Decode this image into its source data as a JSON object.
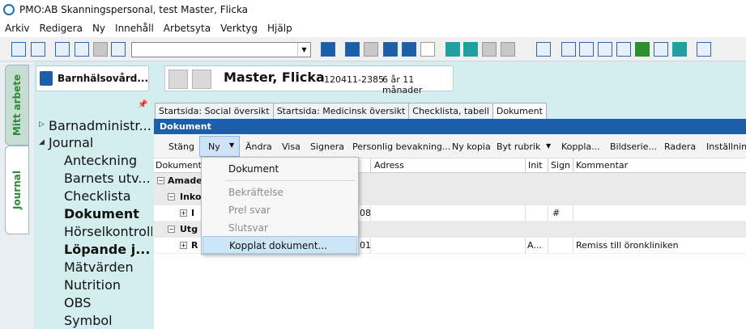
{
  "window": {
    "title": "PMO:AB Skanningspersonal, test  Master, Flicka"
  },
  "menubar": [
    "Arkiv",
    "Redigera",
    "Ny",
    "Innehåll",
    "Arbetsyta",
    "Verktyg",
    "Hjälp"
  ],
  "toolbar": {
    "combo_value": ""
  },
  "side_tabs": {
    "mitt_arbete": "Mitt arbete",
    "journal": "Journal"
  },
  "record": {
    "label": "Barnhälsovård..."
  },
  "tree": {
    "barnadmin": "Barnadministr...",
    "journal": "Journal",
    "items": [
      "Anteckning",
      "Barnets utv...",
      "Checklista",
      "Dokument",
      "Hörselkontroll",
      "Löpande j...",
      "Mätvärden",
      "Nutrition",
      "OBS",
      "Symbol"
    ]
  },
  "patient": {
    "name": "Master, Flicka",
    "pnr": "120411-2385",
    "age": "6 år 11 månader"
  },
  "tabs": [
    "Startsida: Social översikt",
    "Startsida: Medicinsk översikt",
    "Checklista, tabell",
    "Dokument"
  ],
  "document": {
    "header": "Dokument",
    "toolbar": [
      "Stäng",
      "Ny",
      "Ändra",
      "Visa",
      "Signera",
      "Personlig bevakning...",
      "Ny kopia",
      "Byt rubrik",
      "Koppla...",
      "Bildserie...",
      "Radera",
      "Inställning"
    ],
    "columns": [
      "Dokument",
      "Adress",
      "Init",
      "Sign",
      "Kommentar"
    ],
    "rows": {
      "group1": "Amade",
      "group2": "Inko",
      "row1_prefix": "I",
      "row1_date": "08",
      "row1_sign": "#",
      "group3": "Utg",
      "row2_prefix": "R",
      "row2_date": "01",
      "row2_init": "A...",
      "row2_comment": "Remiss till öronkliniken"
    }
  },
  "dropdown": {
    "items": [
      "Dokument",
      "Bekräftelse",
      "Prel svar",
      "Slutsvar",
      "Kopplat dokument..."
    ]
  }
}
